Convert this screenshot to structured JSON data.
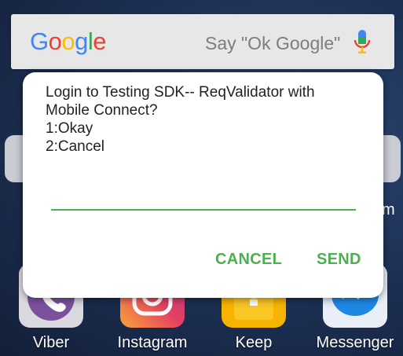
{
  "search_widget": {
    "logo_letters": [
      {
        "char": "G",
        "color": "#4285F4"
      },
      {
        "char": "o",
        "color": "#EA4335"
      },
      {
        "char": "o",
        "color": "#FBBC05"
      },
      {
        "char": "g",
        "color": "#4285F4"
      },
      {
        "char": "l",
        "color": "#34A853"
      },
      {
        "char": "e",
        "color": "#EA4335"
      }
    ],
    "hint": "Say \"Ok Google\"",
    "mic_icon": "microphone-icon"
  },
  "dialog": {
    "message_lines": [
      "Login to Testing SDK-- ReqValidator with",
      "Mobile Connect?",
      "1:Okay",
      "2:Cancel"
    ],
    "input_value": "",
    "accent_color": "#4CAF50",
    "cancel_label": "CANCEL",
    "send_label": "SEND"
  },
  "dock": {
    "apps": [
      {
        "label": "Viber",
        "icon": "viber-icon",
        "color": "#7b519d"
      },
      {
        "label": "Instagram",
        "icon": "instagram-icon",
        "color": "#e4405f"
      },
      {
        "label": "Keep",
        "icon": "keep-icon",
        "color": "#f6b400"
      },
      {
        "label": "Messenger",
        "icon": "messenger-icon",
        "color": "#1e88e5"
      }
    ]
  },
  "background": {
    "peek_label_fragment": "m"
  }
}
